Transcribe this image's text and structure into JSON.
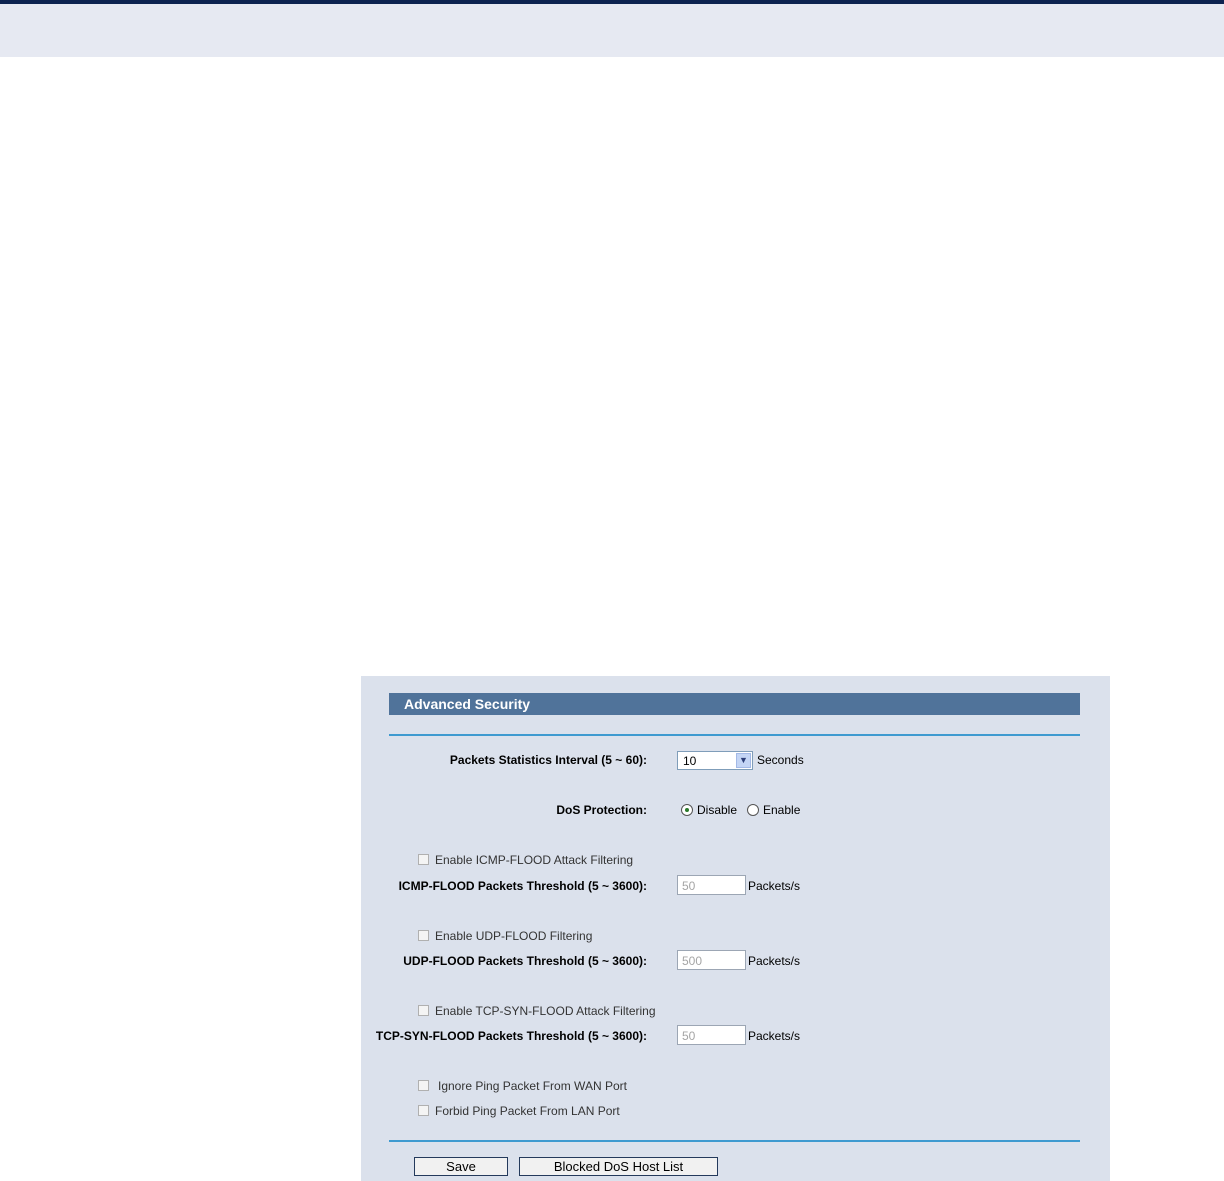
{
  "panel": {
    "title": "Advanced Security",
    "stats_interval": {
      "label": "Packets Statistics Interval (5 ~ 60):",
      "value": "10",
      "unit": "Seconds"
    },
    "dos_protection": {
      "label": "DoS Protection:",
      "options": [
        "Disable",
        "Enable"
      ],
      "selected": "Disable"
    },
    "icmp": {
      "checkbox": "Enable ICMP-FLOOD Attack Filtering",
      "label": "ICMP-FLOOD Packets Threshold (5 ~ 3600):",
      "value": "50",
      "unit": "Packets/s"
    },
    "udp": {
      "checkbox": "Enable UDP-FLOOD Filtering",
      "label": "UDP-FLOOD Packets Threshold (5 ~ 3600):",
      "value": "500",
      "unit": "Packets/s"
    },
    "tcp": {
      "checkbox": "Enable TCP-SYN-FLOOD Attack Filtering",
      "label": "TCP-SYN-FLOOD Packets Threshold (5 ~ 3600):",
      "value": "50",
      "unit": "Packets/s"
    },
    "ignore_wan": "Ignore Ping Packet From WAN Port",
    "forbid_lan": "Forbid Ping Packet From LAN Port",
    "buttons": {
      "save": "Save",
      "blocked_list": "Blocked DoS Host List"
    }
  },
  "colors": {
    "title_bar": "#50739a",
    "panel_bg": "#dbe1ec",
    "rule": "#3e9ad0"
  }
}
